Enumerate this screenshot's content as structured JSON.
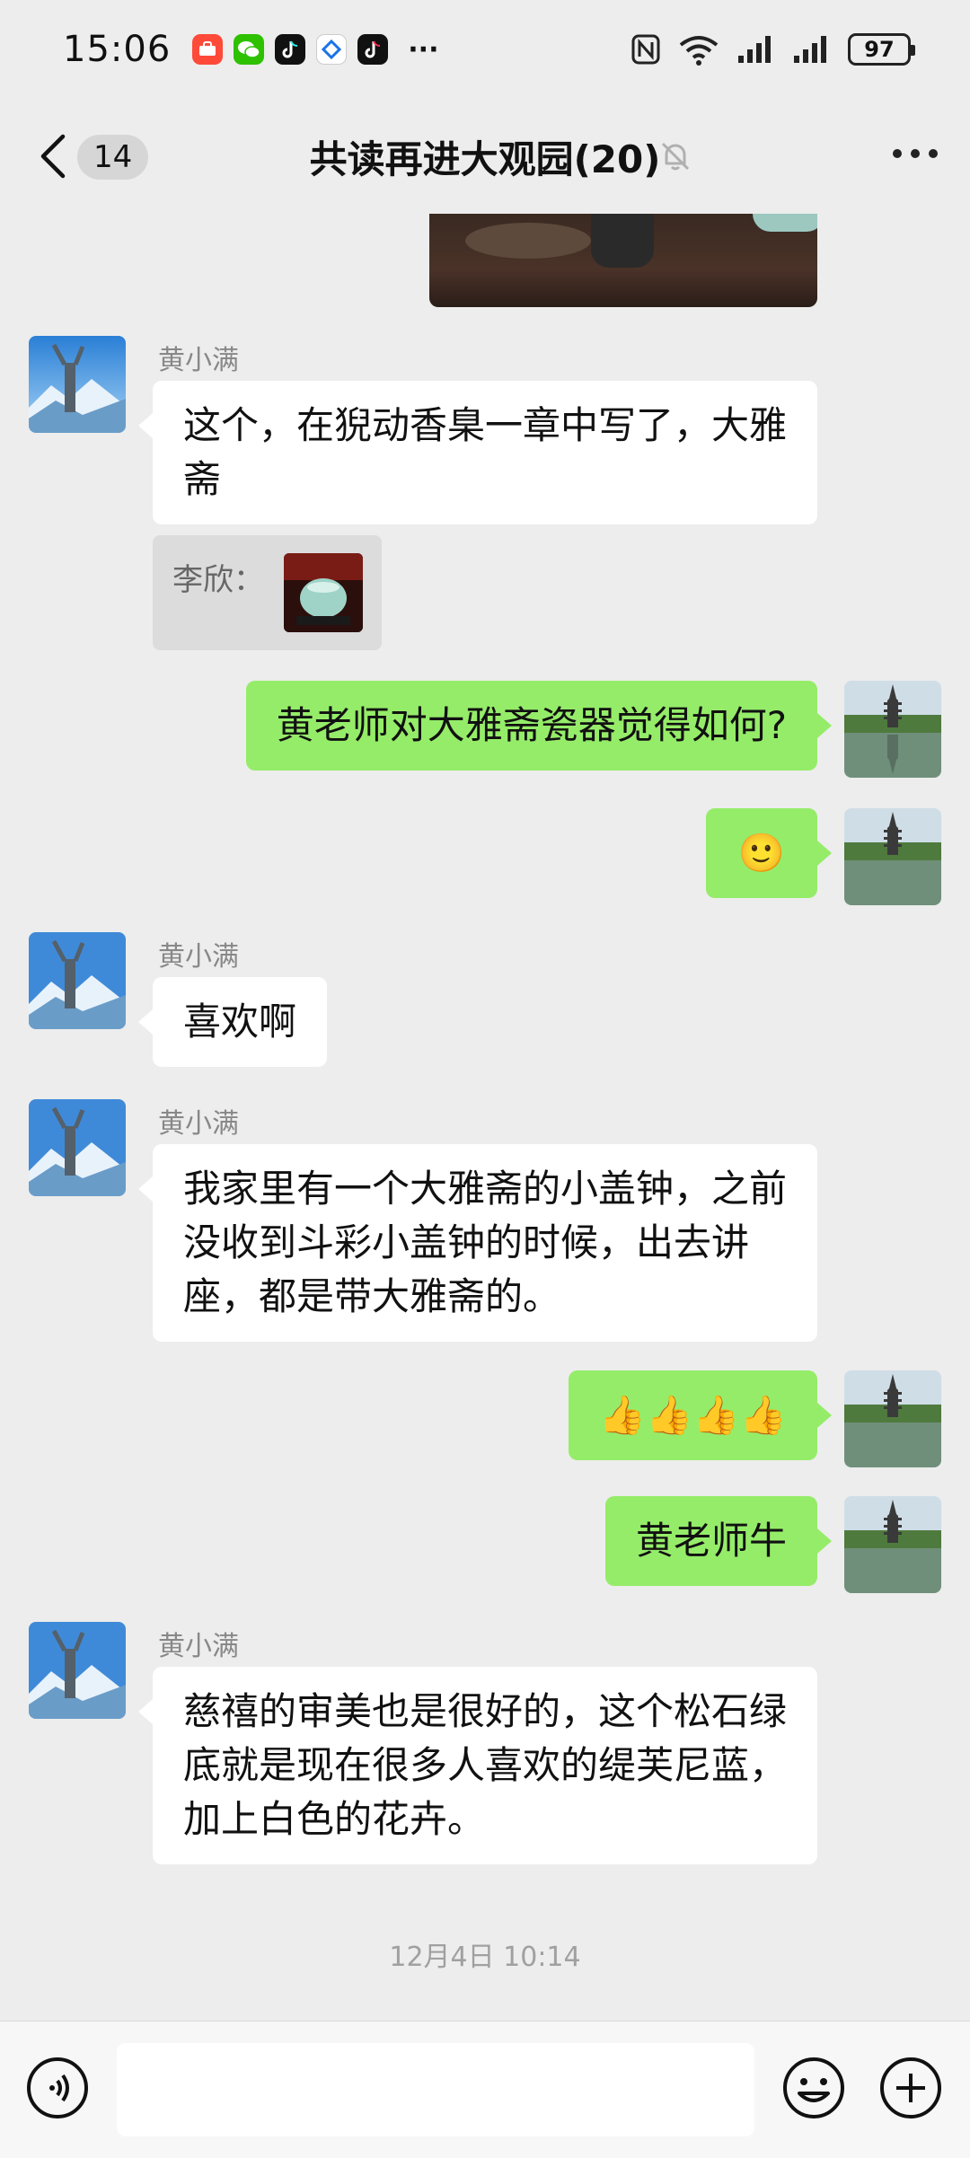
{
  "status_bar": {
    "time": "15:06",
    "battery": "97",
    "app_icons": [
      "taobao-icon",
      "wechat-icon",
      "douyin-icon",
      "bank-app-icon",
      "douyin-icon"
    ],
    "overflow": "···"
  },
  "header": {
    "unread_count": "14",
    "title": "共读再进大观园(20)"
  },
  "messages": [
    {
      "direction": "in",
      "sender": "黄小满",
      "text": "这个，在猊动香臬一章中写了，大雅斋"
    },
    {
      "quote": {
        "author": "李欣："
      }
    },
    {
      "direction": "out",
      "text": "黄老师对大雅斋瓷器觉得如何?"
    },
    {
      "direction": "out",
      "text": "🙂"
    },
    {
      "direction": "in",
      "sender": "黄小满",
      "text": "喜欢啊"
    },
    {
      "direction": "in",
      "sender": "黄小满",
      "text": "我家里有一个大雅斋的小盖钟，之前没收到斗彩小盖钟的时候，出去讲座，都是带大雅斋的。"
    },
    {
      "direction": "out",
      "text": "👍👍👍👍"
    },
    {
      "direction": "out",
      "text": "黄老师牛"
    },
    {
      "direction": "in",
      "sender": "黄小满",
      "text": "慈禧的审美也是很好的，这个松石绿底就是现在很多人喜欢的缇芙尼蓝，加上白色的花卉。"
    }
  ],
  "timestamp": "12月4日 10:14",
  "input": {
    "value": ""
  },
  "colors": {
    "outgoing_bubble": "#95ec69",
    "incoming_bubble": "#ffffff",
    "background": "#ededed"
  }
}
